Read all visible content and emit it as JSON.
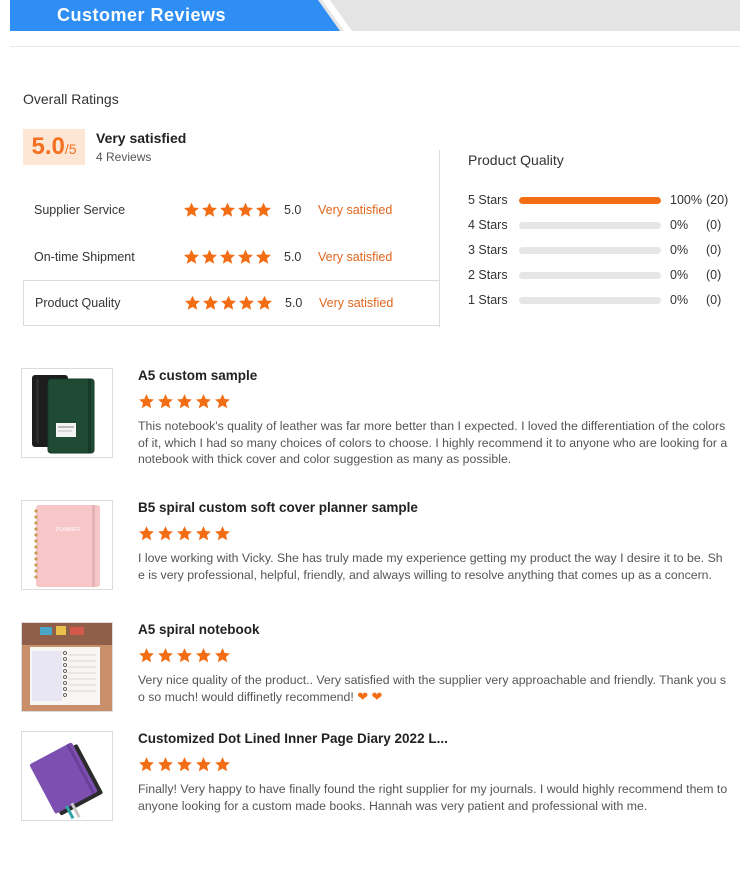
{
  "header": {
    "title": "Customer Reviews"
  },
  "overall": {
    "label": "Overall Ratings",
    "score": "5.0",
    "score_denominator": "/5",
    "satisfaction": "Very satisfied",
    "review_count": "4 Reviews"
  },
  "categories": [
    {
      "label": "Supplier Service",
      "stars": 5,
      "score": "5.0",
      "text": "Very satisfied"
    },
    {
      "label": "On-time Shipment",
      "stars": 5,
      "score": "5.0",
      "text": "Very satisfied"
    },
    {
      "label": "Product Quality",
      "stars": 5,
      "score": "5.0",
      "text": "Very satisfied"
    }
  ],
  "product_quality": {
    "title": "Product Quality",
    "rows": [
      {
        "label": "5  Stars",
        "fraction": 1.0,
        "percent": "100%",
        "count": "(20)"
      },
      {
        "label": "4  Stars",
        "fraction": 0.0,
        "percent": "0%",
        "count": "(0)"
      },
      {
        "label": "3  Stars",
        "fraction": 0.0,
        "percent": "0%",
        "count": "(0)"
      },
      {
        "label": "2  Stars",
        "fraction": 0.0,
        "percent": "0%",
        "count": "(0)"
      },
      {
        "label": "1  Stars",
        "fraction": 0.0,
        "percent": "0%",
        "count": "(0)"
      }
    ]
  },
  "reviews": [
    {
      "title": "A5 custom sample",
      "stars": 5,
      "text": "This notebook's quality of leather was far more better than I expected. I loved the differentiation of the colors of it, which I had so many choices of colors to choose. I highly recommend it to anyone who are looking for a notebook with thick cover and color suggestion as many as possible.",
      "thumbnail": "green-notebook-image"
    },
    {
      "title": "B5 spiral custom soft cover planner sample",
      "stars": 5,
      "text": "I love working with Vicky. She has truly made my experience getting my product the way I desire it to be. She is very professional, helpful, friendly, and always willing to resolve anything that comes up as a concern.",
      "thumbnail": "pink-planner-image",
      "thumbnail_text": "PLANNER"
    },
    {
      "title": "A5 spiral notebook",
      "stars": 5,
      "text": "Very nice quality of the product.. Very satisfied with the supplier very approachable and friendly. Thank you so so much! would diffinetly recommend!",
      "hearts": 2,
      "thumbnail": "spiral-notebook-image"
    },
    {
      "title": "Customized Dot Lined Inner Page Diary 2022 L...",
      "stars": 5,
      "text": "Finally! Very happy to have finally found the right supplier for my journals. I would highly recommend them to anyone looking for a custom made books. Hannah was very patient and professional with me.",
      "thumbnail": "purple-diary-image"
    }
  ],
  "colors": {
    "accent": "#f36d15",
    "banner": "#2f8ef4",
    "star": "#f36d15"
  }
}
